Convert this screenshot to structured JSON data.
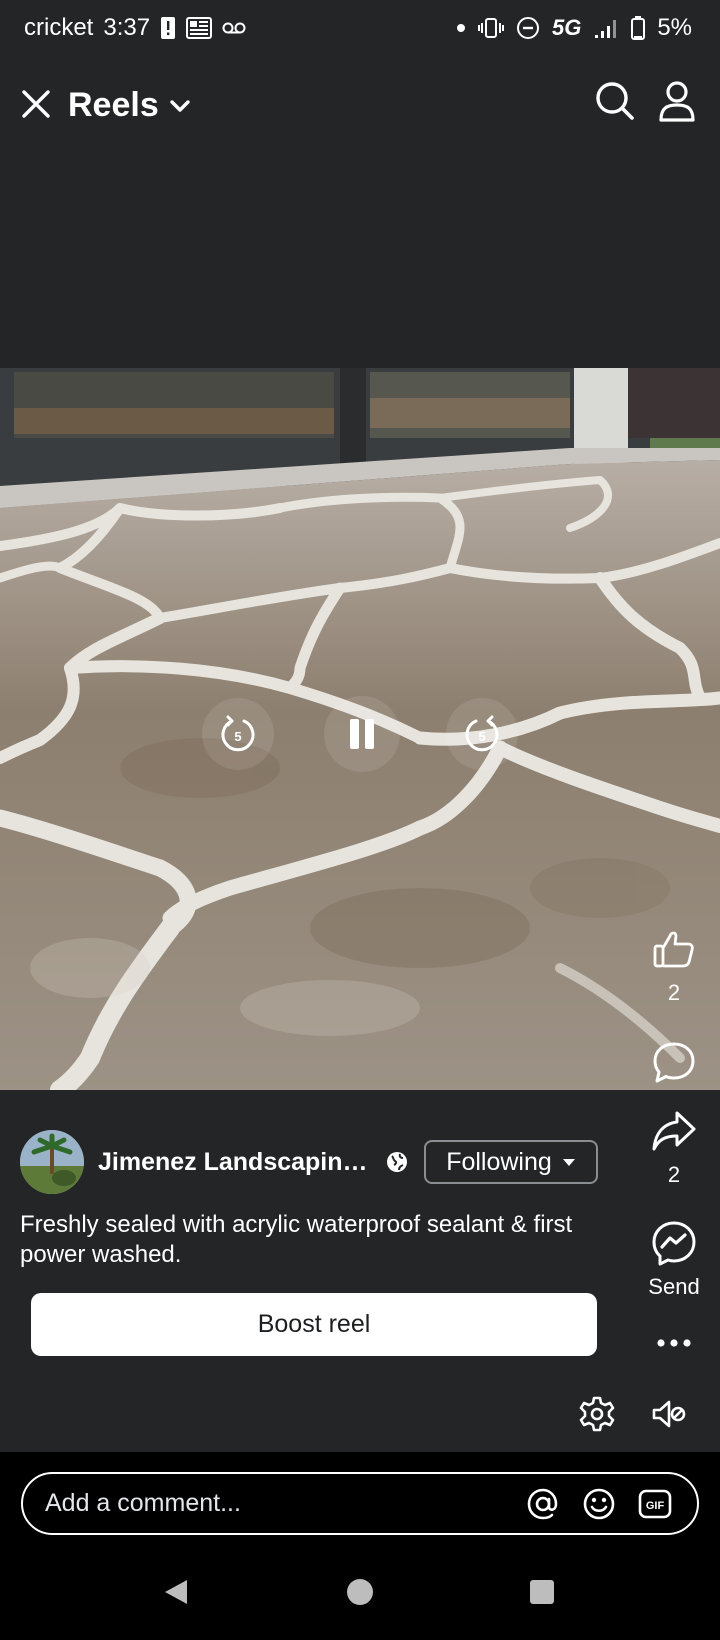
{
  "status_bar": {
    "carrier": "cricket",
    "time": "3:37",
    "network": "5G",
    "battery": "5%"
  },
  "header": {
    "title": "Reels"
  },
  "video": {
    "rewind_label": "5",
    "forward_label": "5"
  },
  "actions": {
    "like_count": "2",
    "share_count": "2",
    "send_label": "Send"
  },
  "post": {
    "author": "Jimenez Landscaping,...",
    "follow_label": "Following",
    "caption": "Freshly sealed with acrylic waterproof sealant & first power washed.",
    "boost_label": "Boost reel"
  },
  "comment": {
    "placeholder": "Add a comment...",
    "gif_label": "GIF"
  }
}
